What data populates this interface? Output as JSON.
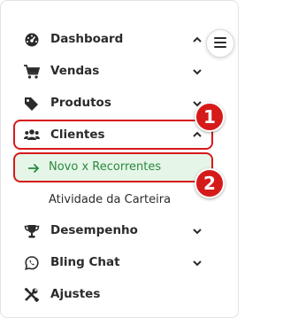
{
  "menu": {
    "items": [
      {
        "label": "Dashboard",
        "icon": "dashboard-gauge-icon",
        "chevron": "up"
      },
      {
        "label": "Vendas",
        "icon": "shopping-cart-icon",
        "chevron": "down"
      },
      {
        "label": "Produtos",
        "icon": "tag-icon",
        "chevron": "down"
      },
      {
        "label": "Clientes",
        "icon": "users-icon",
        "chevron": "up"
      },
      {
        "label": "Desempenho",
        "icon": "trophy-icon",
        "chevron": "down"
      },
      {
        "label": "Bling Chat",
        "icon": "whatsapp-icon",
        "chevron": "down"
      },
      {
        "label": "Ajustes",
        "icon": "tools-icon"
      }
    ],
    "clientes_sub": [
      {
        "label": "Novo x Recorrentes",
        "active": true,
        "icon": "arrow-right-icon"
      },
      {
        "label": "Atividade da Carteira",
        "active": false
      }
    ]
  },
  "annotations": [
    "1",
    "2"
  ],
  "colors": {
    "highlight_border": "#d61a1a",
    "active_bg": "#e5f5e8",
    "active_text": "#2a8a3d",
    "badge": "#d61a1a"
  },
  "toggle_icon": "hamburger-icon"
}
